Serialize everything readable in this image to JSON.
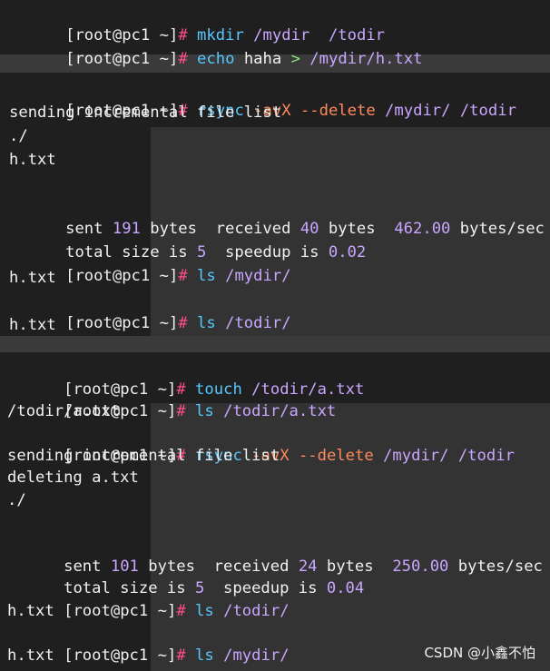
{
  "prompt": {
    "open": "[",
    "user_host": "root@pc1",
    "dir": "~",
    "close": "]",
    "hash": "#"
  },
  "block1": {
    "l1": {
      "cmd": "mkdir",
      "args": "/mydir  /todir"
    },
    "l2": {
      "cmd": "echo",
      "text": "haha",
      "gt": ">",
      "args": "/mydir/h.txt"
    }
  },
  "block2": {
    "l1": {
      "cmd": "rsync",
      "opts": "-avX --delete",
      "args": "/mydir/ /todir"
    },
    "l2": "sending incremental file list",
    "l3": "./",
    "l4": "h.txt",
    "l5": {
      "a": "sent ",
      "n1": "191",
      "b": " bytes  received ",
      "n2": "40",
      "c": " bytes  ",
      "n3": "462.00",
      "d": " bytes/sec"
    },
    "l6": {
      "a": "total size is ",
      "n1": "5",
      "b": "  speedup is ",
      "n2": "0.02"
    },
    "l7": {
      "cmd": "ls",
      "args": "/mydir/"
    },
    "l8": "h.txt",
    "l9": {
      "cmd": "ls",
      "args": "/todir/"
    },
    "l10": "h.txt"
  },
  "block3": {
    "l1": {
      "cmd": "touch",
      "args": "/todir/a.txt"
    },
    "l2": {
      "cmd": "ls",
      "args": "/todir/a.txt"
    },
    "l3": "/todir/a.txt",
    "l4": {
      "cmd": "rsync",
      "opts": "-avX --delete",
      "args": "/mydir/ /todir"
    },
    "l5": "sending incremental file list",
    "l6": "deleting a.txt",
    "l7": "./",
    "l8": {
      "a": "sent ",
      "n1": "101",
      "b": " bytes  received ",
      "n2": "24",
      "c": " bytes  ",
      "n3": "250.00",
      "d": " bytes/sec"
    },
    "l9": {
      "a": "total size is ",
      "n1": "5",
      "b": "  speedup is ",
      "n2": "0.04"
    },
    "l10": {
      "cmd": "ls",
      "args": "/todir/"
    },
    "l11": "h.txt",
    "l12": {
      "cmd": "ls",
      "args": "/mydir/"
    },
    "l13": "h.txt"
  },
  "watermark": "CSDN @小鑫不怕"
}
